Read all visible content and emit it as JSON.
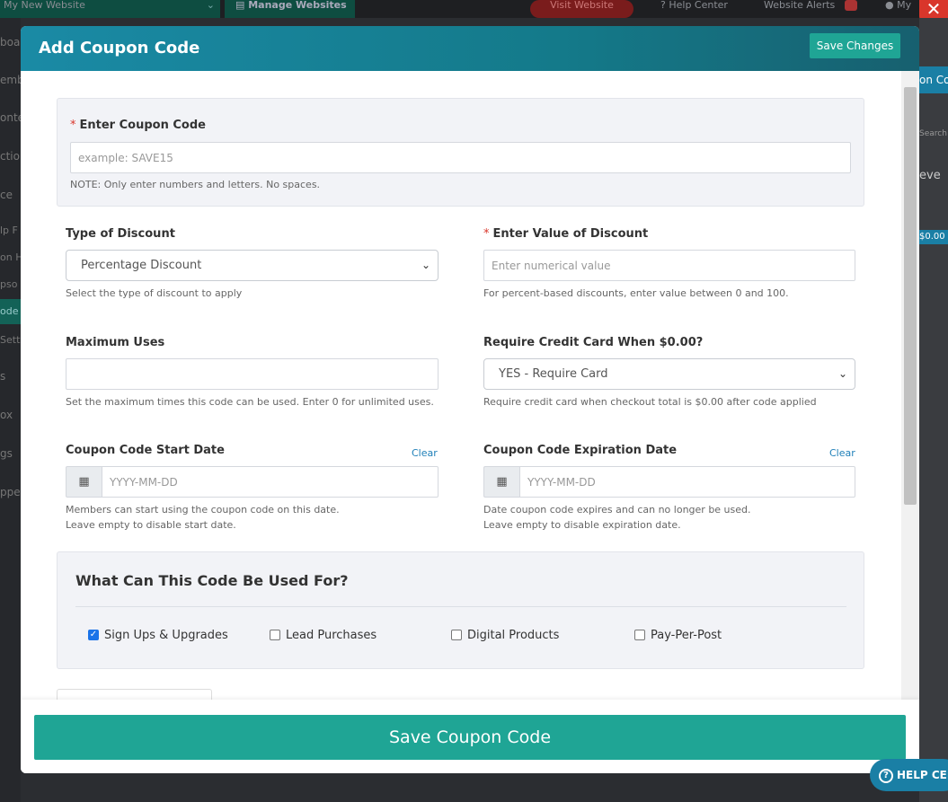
{
  "topbar": {
    "site_name": "My New Website",
    "manage": "Manage Websites",
    "visit": "Visit Website",
    "help": "Help Center",
    "alerts": "Website Alerts",
    "user": "My"
  },
  "leftnav": [
    "board",
    "ember",
    "onte",
    "ctio",
    "ce",
    "lp F",
    "on H",
    "pso",
    "ode",
    "Setti",
    "s",
    "ox",
    "gs",
    "ppe"
  ],
  "rightbg": {
    "tab": "on Co",
    "small": "Search Coupo",
    "title": "eve",
    "price": "$0.00"
  },
  "modal": {
    "title": "Add Coupon Code",
    "save_changes": "Save Changes",
    "coupon": {
      "label": "Enter Coupon Code",
      "placeholder": "example: SAVE15",
      "note": "NOTE: Only enter numbers and letters. No spaces."
    },
    "discount_type": {
      "label": "Type of Discount",
      "selected": "Percentage Discount",
      "note": "Select the type of discount to apply"
    },
    "discount_value": {
      "label": "Enter Value of Discount",
      "placeholder": "Enter numerical value",
      "note": "For percent-based discounts, enter value between 0 and 100."
    },
    "max_uses": {
      "label": "Maximum Uses",
      "value": "",
      "note": "Set the maximum times this code can be used. Enter 0 for unlimited uses."
    },
    "require_card": {
      "label": "Require Credit Card When $0.00?",
      "selected": "YES - Require Card",
      "note": "Require credit card when checkout total is $0.00 after code applied"
    },
    "start_date": {
      "label": "Coupon Code Start Date",
      "clear": "Clear",
      "placeholder": "YYYY-MM-DD",
      "note1": "Members can start using the coupon code on this date.",
      "note2": "Leave empty to disable start date."
    },
    "expiration_date": {
      "label": "Coupon Code Expiration Date",
      "clear": "Clear",
      "placeholder": "YYYY-MM-DD",
      "note1": "Date coupon code expires and can no longer be used.",
      "note2": "Leave empty to disable expiration date."
    },
    "usage": {
      "title": "What Can This Code Be Used For?",
      "options": [
        {
          "label": "Sign Ups & Upgrades",
          "checked": true
        },
        {
          "label": "Lead Purchases",
          "checked": false
        },
        {
          "label": "Digital Products",
          "checked": false
        },
        {
          "label": "Pay-Per-Post",
          "checked": false
        }
      ]
    },
    "save_coupon": "Save Coupon Code"
  },
  "help_button": "HELP CENTER",
  "colors": {
    "accent": "#1fa595",
    "header": "#1a8aa5",
    "close": "#d9362b",
    "link": "#1e7fb8"
  }
}
